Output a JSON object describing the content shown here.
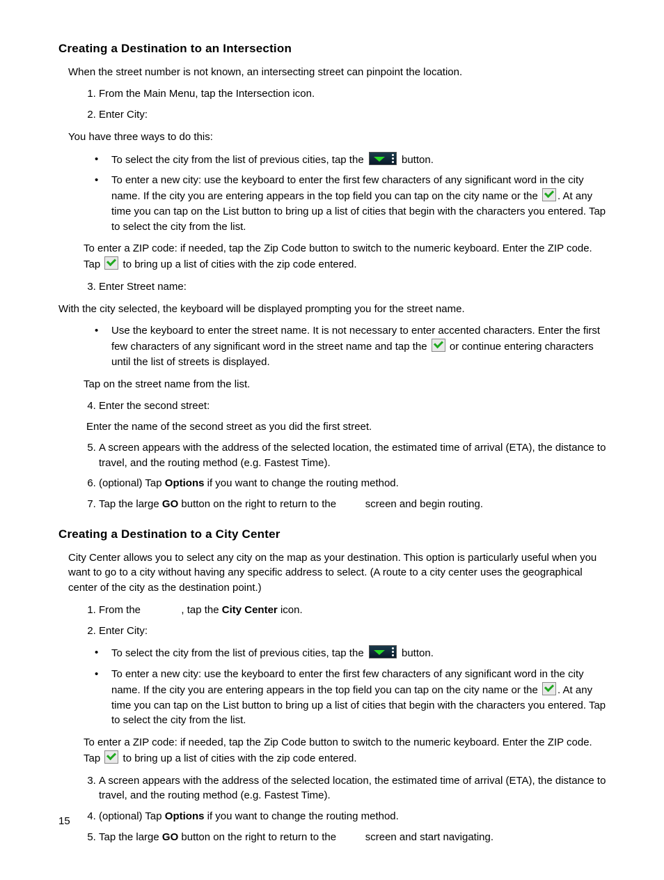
{
  "s1": {
    "heading": "Creating a Destination to an Intersection",
    "intro": "When the street number is not known, an intersecting street can pinpoint the location.",
    "step1": "From the Main Menu, tap the Intersection icon.",
    "step2": "Enter City:",
    "three_ways": "You have three ways to do this:",
    "b1a": "To select the city from the list of previous cities, tap the ",
    "b1b": " button.",
    "b2a": "To enter a new city: use the keyboard to enter the first few characters of any significant word in the city name. If the city you are entering appears in the top field you can tap on the city name or the ",
    "b2b": ". At any time you can tap on the List button to bring up a list of cities that begin with the characters you entered. Tap to select the city from the list.",
    "zip_a": "To enter a ZIP code: if needed, tap the Zip Code button to switch to the numeric keyboard. Enter the ZIP code. Tap ",
    "zip_b": " to bring up a list of cities with the zip code entered.",
    "step3": "Enter Street name:",
    "street_intro": "With the city selected, the keyboard will be displayed prompting you for the street name.",
    "street_b1a": "Use the keyboard to enter the street name. It is not necessary to enter accented characters. Enter the first few characters of any significant word in the street name and tap the ",
    "street_b1b": " or continue entering characters until the list of streets is displayed.",
    "street_tap": "Tap on the street name from the list.",
    "step4": "Enter the second street:",
    "step4_sub": "Enter the name of the second street as you did the first street.",
    "step5": "A screen appears with the address of the selected location, the estimated time of arrival (ETA), the distance to travel, and the routing method (e.g. Fastest Time).",
    "step6a": "(optional) Tap ",
    "step6b": "Options",
    "step6c": " if you want to change the routing method.",
    "step7a": "Tap the large ",
    "step7b": "GO",
    "step7c": " button on the right to return to the ",
    "step7d": " screen and begin routing."
  },
  "s2": {
    "heading": "Creating a Destination to a City Center",
    "intro": "City Center allows you to select any city on the map as your destination. This option is particularly useful when you want to go to a city without having any specific address to select.  (A route to a city center uses the geographical center of the city as the destination point.)",
    "step1a": "From the ",
    "step1b": ", tap the ",
    "step1c": "City Center",
    "step1d": " icon.",
    "step2": "Enter City:",
    "b1a": "To select the city from the list of previous cities, tap the ",
    "b1b": " button.",
    "b2a": "To enter a new city: use the keyboard to enter the first few characters of any significant word in the city name. If the city you are entering appears in the top field you can tap on the city name or the ",
    "b2b": ". At any time you can tap on the List button to bring up a list of cities that begin with the characters you entered. Tap to select the city from the list.",
    "zip_a": "To enter a ZIP code: if needed, tap the Zip Code button to switch to the numeric keyboard. Enter the ZIP code. Tap ",
    "zip_b": " to bring up a list of cities with the zip code entered.",
    "step3": "A screen appears with the address of the selected location, the estimated time of arrival (ETA), the distance to travel, and the routing method (e.g. Fastest Time).",
    "step4a": "(optional) Tap ",
    "step4b": "Options",
    "step4c": " if you want to change the routing method.",
    "step5a": "Tap the large ",
    "step5b": "GO",
    "step5c": " button on the right to return to the ",
    "step5d": " screen and start navigating."
  },
  "page_number": "15"
}
